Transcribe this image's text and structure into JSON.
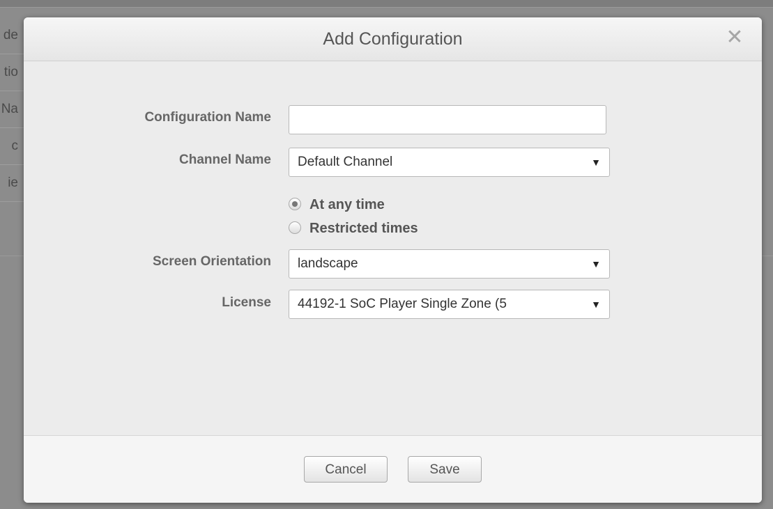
{
  "background_rows": [
    "de",
    "tio",
    "Na",
    "c",
    "ie"
  ],
  "modal": {
    "title": "Add Configuration",
    "close_glyph": "✕"
  },
  "form": {
    "configuration_name": {
      "label": "Configuration Name",
      "value": ""
    },
    "channel_name": {
      "label": "Channel Name",
      "selected": "Default Channel"
    },
    "schedule_options": [
      {
        "label": "At any time",
        "checked": true
      },
      {
        "label": "Restricted times",
        "checked": false
      }
    ],
    "screen_orientation": {
      "label": "Screen Orientation",
      "selected": "landscape"
    },
    "license": {
      "label": "License",
      "selected": "44192-1 SoC Player Single Zone (5"
    }
  },
  "footer": {
    "cancel_label": "Cancel",
    "save_label": "Save"
  },
  "colors": {
    "modal_bg": "#ececec",
    "overlay": "#8c8c8c",
    "label_text": "#666666"
  },
  "icons": {
    "close": "close-icon",
    "dropdown": "chevron-down-icon"
  }
}
